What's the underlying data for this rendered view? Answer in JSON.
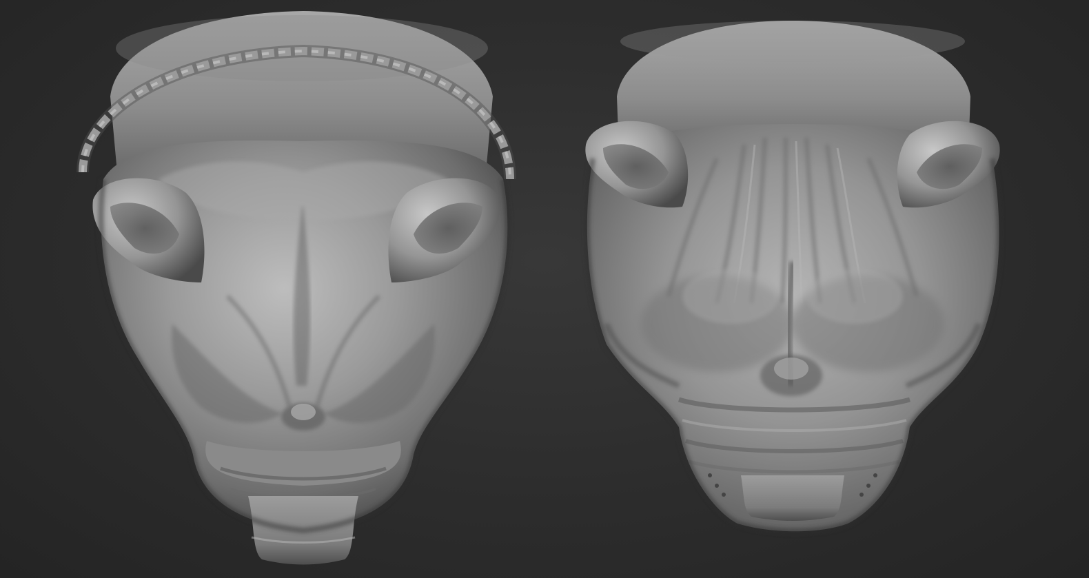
{
  "scene": {
    "background_color": "#2a2a2a",
    "material_color": "#8e8e8e",
    "models": [
      {
        "name": "sculpt-head-with-chain",
        "has_chain": true
      },
      {
        "name": "sculpt-head-wrinkled",
        "has_chain": false
      }
    ]
  }
}
